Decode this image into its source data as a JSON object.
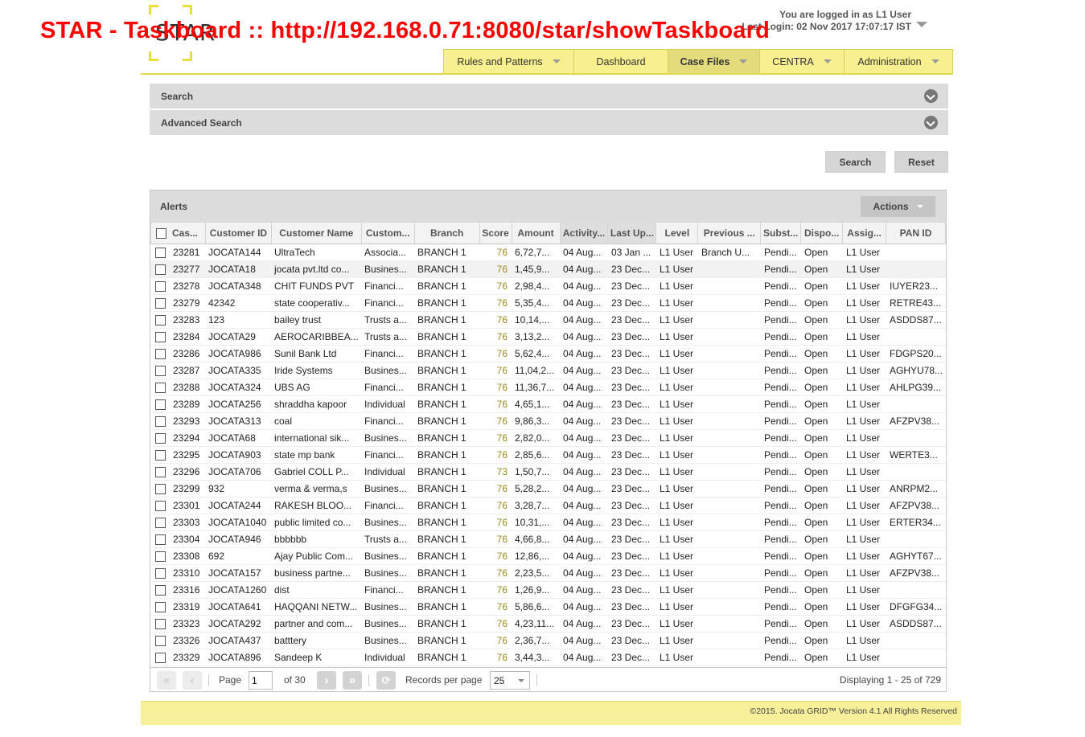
{
  "window_title": "STAR - Taskboard :: http://192.168.0.71:8080/star/showTaskboard",
  "logo_text": "STAR",
  "user": {
    "logged_in": "You are logged in as L1 User",
    "last_login": "Last Login: 02 Nov 2017 17:07:17 IST"
  },
  "nav": [
    {
      "label": "Rules and Patterns",
      "dropdown": true
    },
    {
      "label": "Dashboard",
      "dropdown": false
    },
    {
      "label": "Case Files",
      "dropdown": true,
      "active": true
    },
    {
      "label": "CENTRA",
      "dropdown": true
    },
    {
      "label": "Administration",
      "dropdown": true
    }
  ],
  "search_panel": "Search",
  "advanced_search_panel": "Advanced Search",
  "search_button": "Search",
  "reset_button": "Reset",
  "grid": {
    "title": "Alerts",
    "actions_label": "Actions",
    "columns": [
      "Cas...",
      "Customer ID",
      "Customer Name",
      "Custom...",
      "Branch",
      "Score",
      "Amount",
      "Activity...",
      "Last Up...",
      "Level",
      "Previous ...",
      "Subst...",
      "Dispo...",
      "Assig...",
      "PAN ID"
    ],
    "rows": [
      [
        "23281",
        "JOCATA144",
        "UltraTech",
        "Associa...",
        "BRANCH 1",
        "76",
        "6,72,7...",
        "04 Aug...",
        "03 Jan ...",
        "L1 User",
        "Branch U...",
        "Pendi...",
        "Open",
        "L1 User",
        ""
      ],
      [
        "23277",
        "JOCATA18",
        "jocata pvt.ltd co...",
        "Busines...",
        "BRANCH 1",
        "76",
        "1,45,9...",
        "04 Aug...",
        "23 Dec...",
        "L1 User",
        "",
        "Pendi...",
        "Open",
        "L1 User",
        ""
      ],
      [
        "23278",
        "JOCATA348",
        "CHIT FUNDS PVT",
        "Financi...",
        "BRANCH 1",
        "76",
        "2,98,4...",
        "04 Aug...",
        "23 Dec...",
        "L1 User",
        "",
        "Pendi...",
        "Open",
        "L1 User",
        "IUYER23..."
      ],
      [
        "23279",
        "42342",
        "state cooperativ...",
        "Financi...",
        "BRANCH 1",
        "76",
        "5,35,4...",
        "04 Aug...",
        "23 Dec...",
        "L1 User",
        "",
        "Pendi...",
        "Open",
        "L1 User",
        "RETRE43..."
      ],
      [
        "23283",
        "123",
        "bailey trust",
        "Trusts a...",
        "BRANCH 1",
        "76",
        "10,14,...",
        "04 Aug...",
        "23 Dec...",
        "L1 User",
        "",
        "Pendi...",
        "Open",
        "L1 User",
        "ASDDS87..."
      ],
      [
        "23284",
        "JOCATA29",
        "AEROCARIBBEA...",
        "Trusts a...",
        "BRANCH 1",
        "76",
        "3,13,2...",
        "04 Aug...",
        "23 Dec...",
        "L1 User",
        "",
        "Pendi...",
        "Open",
        "L1 User",
        ""
      ],
      [
        "23286",
        "JOCATA986",
        "Sunil Bank Ltd",
        "Financi...",
        "BRANCH 1",
        "76",
        "5,62,4...",
        "04 Aug...",
        "23 Dec...",
        "L1 User",
        "",
        "Pendi...",
        "Open",
        "L1 User",
        "FDGPS20..."
      ],
      [
        "23287",
        "JOCATA335",
        "Iride Systems",
        "Busines...",
        "BRANCH 1",
        "76",
        "11,04,2...",
        "04 Aug...",
        "23 Dec...",
        "L1 User",
        "",
        "Pendi...",
        "Open",
        "L1 User",
        "AGHYU78..."
      ],
      [
        "23288",
        "JOCATA324",
        "UBS AG",
        "Financi...",
        "BRANCH 1",
        "76",
        "11,36,7...",
        "04 Aug...",
        "23 Dec...",
        "L1 User",
        "",
        "Pendi...",
        "Open",
        "L1 User",
        "AHLPG39..."
      ],
      [
        "23289",
        "JOCATA256",
        "shraddha kapoor",
        "Individual",
        "BRANCH 1",
        "76",
        "4,65,1...",
        "04 Aug...",
        "23 Dec...",
        "L1 User",
        "",
        "Pendi...",
        "Open",
        "L1 User",
        ""
      ],
      [
        "23293",
        "JOCATA313",
        "coal",
        "Financi...",
        "BRANCH 1",
        "76",
        "9,86,3...",
        "04 Aug...",
        "23 Dec...",
        "L1 User",
        "",
        "Pendi...",
        "Open",
        "L1 User",
        "AFZPV38..."
      ],
      [
        "23294",
        "JOCATA68",
        "international sik...",
        "Busines...",
        "BRANCH 1",
        "76",
        "2,82,0...",
        "04 Aug...",
        "23 Dec...",
        "L1 User",
        "",
        "Pendi...",
        "Open",
        "L1 User",
        ""
      ],
      [
        "23295",
        "JOCATA903",
        "state mp bank",
        "Financi...",
        "BRANCH 1",
        "76",
        "2,85,6...",
        "04 Aug...",
        "23 Dec...",
        "L1 User",
        "",
        "Pendi...",
        "Open",
        "L1 User",
        "WERTE3..."
      ],
      [
        "23296",
        "JOCATA706",
        "Gabriel COLL P...",
        "Individual",
        "BRANCH 1",
        "73",
        "1,50,7...",
        "04 Aug...",
        "23 Dec...",
        "L1 User",
        "",
        "Pendi...",
        "Open",
        "L1 User",
        ""
      ],
      [
        "23299",
        "932",
        "verma & verma,s",
        "Busines...",
        "BRANCH 1",
        "76",
        "5,28,2...",
        "04 Aug...",
        "23 Dec...",
        "L1 User",
        "",
        "Pendi...",
        "Open",
        "L1 User",
        "ANRPM2..."
      ],
      [
        "23301",
        "JOCATA244",
        "RAKESH BLOO...",
        "Financi...",
        "BRANCH 1",
        "76",
        "3,28,7...",
        "04 Aug...",
        "23 Dec...",
        "L1 User",
        "",
        "Pendi...",
        "Open",
        "L1 User",
        "AFZPV38..."
      ],
      [
        "23303",
        "JOCATA1040",
        "public limited co...",
        "Busines...",
        "BRANCH 1",
        "76",
        "10,31,...",
        "04 Aug...",
        "23 Dec...",
        "L1 User",
        "",
        "Pendi...",
        "Open",
        "L1 User",
        "ERTER34..."
      ],
      [
        "23304",
        "JOCATA946",
        "bbbbbb",
        "Trusts a...",
        "BRANCH 1",
        "76",
        "4,66,8...",
        "04 Aug...",
        "23 Dec...",
        "L1 User",
        "",
        "Pendi...",
        "Open",
        "L1 User",
        ""
      ],
      [
        "23308",
        "692",
        "Ajay Public Com...",
        "Busines...",
        "BRANCH 1",
        "76",
        "12,86,...",
        "04 Aug...",
        "23 Dec...",
        "L1 User",
        "",
        "Pendi...",
        "Open",
        "L1 User",
        "AGHYT67..."
      ],
      [
        "23310",
        "JOCATA157",
        "business partne...",
        "Busines...",
        "BRANCH 1",
        "76",
        "2,23,5...",
        "04 Aug...",
        "23 Dec...",
        "L1 User",
        "",
        "Pendi...",
        "Open",
        "L1 User",
        "AFZPV38..."
      ],
      [
        "23316",
        "JOCATA1260",
        "dist",
        "Financi...",
        "BRANCH 1",
        "76",
        "1,26,9...",
        "04 Aug...",
        "23 Dec...",
        "L1 User",
        "",
        "Pendi...",
        "Open",
        "L1 User",
        ""
      ],
      [
        "23319",
        "JOCATA641",
        "HAQQANI NETW...",
        "Busines...",
        "BRANCH 1",
        "76",
        "5,86,6...",
        "04 Aug...",
        "23 Dec...",
        "L1 User",
        "",
        "Pendi...",
        "Open",
        "L1 User",
        "DFGFG34..."
      ],
      [
        "23323",
        "JOCATA292",
        "partner and com...",
        "Busines...",
        "BRANCH 1",
        "76",
        "4,23,11...",
        "04 Aug...",
        "23 Dec...",
        "L1 User",
        "",
        "Pendi...",
        "Open",
        "L1 User",
        "ASDDS87..."
      ],
      [
        "23326",
        "JOCATA437",
        "batttery",
        "Busines...",
        "BRANCH 1",
        "76",
        "2,36,7...",
        "04 Aug...",
        "23 Dec...",
        "L1 User",
        "",
        "Pendi...",
        "Open",
        "L1 User",
        ""
      ],
      [
        "23329",
        "JOCATA896",
        "Sandeep K",
        "Individual",
        "BRANCH 1",
        "76",
        "3,44,3...",
        "04 Aug...",
        "23 Dec...",
        "L1 User",
        "",
        "Pendi...",
        "Open",
        "L1 User",
        ""
      ]
    ]
  },
  "pager": {
    "page_label": "Page",
    "page_value": "1",
    "of_label": "of 30",
    "records_label": "Records per page",
    "records_value": "25",
    "displaying": "Displaying 1 - 25 of 729"
  },
  "footer": "©2015. Jocata GRID™ Version 4.1 All Rights Reserved"
}
